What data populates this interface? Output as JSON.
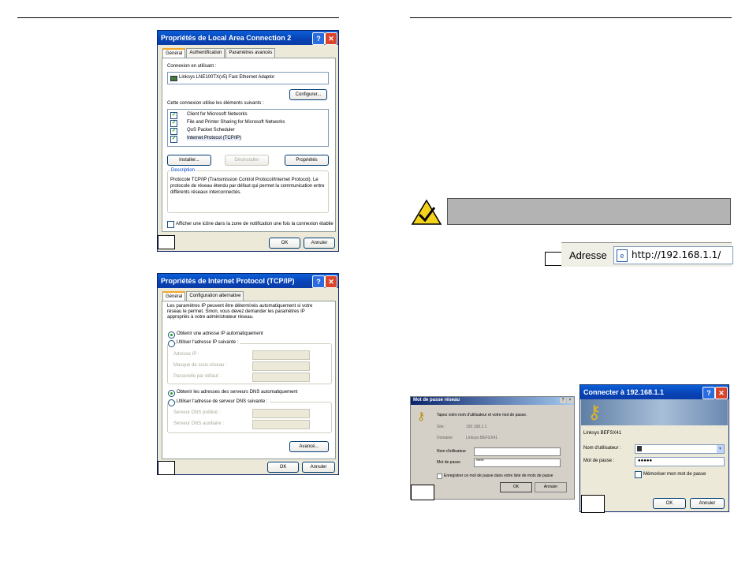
{
  "dialog1": {
    "title": "Propriétés de Local Area Connection 2",
    "tabs": [
      "Général",
      "Authentification",
      "Paramètres avancés"
    ],
    "connect_label": "Connexion en utilisant :",
    "adapter": "Linksys LNE100TX(v5) Fast Ethernet Adaptor",
    "configure_btn": "Configurer...",
    "items_label": "Cette connexion utilise les éléments suivants :",
    "items": [
      "Client for Microsoft Networks",
      "File and Printer Sharing for Microsoft Networks",
      "QoS Packet Scheduler",
      "Internet Protocol (TCP/IP)"
    ],
    "install_btn": "Installer...",
    "uninstall_btn": "Désinstaller",
    "properties_btn": "Propriétés",
    "description_label": "Description",
    "description_lines": [
      "Protocole TCP/IP (Transmission Control Protocol/Internet Protocol). Le",
      "protocole de réseau étendu par défaut qui permet la communication entre",
      "différents réseaux interconnectés."
    ],
    "notify_label": "Afficher une icône dans la zone de notification une fois la connexion établie",
    "ok_btn": "OK",
    "cancel_btn": "Annuler"
  },
  "dialog2": {
    "title": "Propriétés de Internet Protocol (TCP/IP)",
    "tabs": [
      "Général",
      "Configuration alternative"
    ],
    "intro_lines": [
      "Les paramètres IP peuvent être déterminés automatiquement si votre",
      "réseau le permet. Sinon, vous devez demander les paramètres IP",
      "appropriés à votre administrateur réseau."
    ],
    "ip_auto": "Obtenir une adresse IP automatiquement",
    "ip_manual": "Utiliser l'adresse IP suivante :",
    "ip_fields": [
      "Adresse IP :",
      "Masque de sous-réseau :",
      "Passerelle par défaut :"
    ],
    "dns_auto": "Obtenir les adresses des serveurs DNS automatiquement",
    "dns_manual": "Utiliser l'adresse de serveur DNS suivante :",
    "dns_fields": [
      "Serveur DNS préféré :",
      "Serveur DNS auxiliaire :"
    ],
    "advanced_btn": "Avancé...",
    "ok_btn": "OK",
    "cancel_btn": "Annuler"
  },
  "address_bar": {
    "label": "Adresse",
    "url": "http://192.168.1.1/"
  },
  "dialog3": {
    "title": "Mot de passe réseau",
    "prompt": "Tapez votre nom d'utilisateur et votre mot de passe.",
    "site_label": "Site :",
    "site_value": "192.168.1.1",
    "domain_label": "Domaine",
    "domain_value": "Linksys BEFSX41",
    "user_label": "Nom d'utilisateur",
    "pass_label": "Mot de passe",
    "pass_value": "*****",
    "save_label": "Enregistrer ce mot de passe dans votre liste de mots de passe",
    "ok_btn": "OK",
    "cancel_btn": "Annuler"
  },
  "dialog4": {
    "title": "Connecter à 192.168.1.1",
    "realm": "Linksys BEFSX41",
    "user_label": "Nom d'utilisateur :",
    "pass_label": "Mot de passe :",
    "pass_value": "●●●●●",
    "remember_label": "Mémoriser mon mot de passe",
    "ok_btn": "OK",
    "cancel_btn": "Annuler"
  },
  "colors": {
    "xp_title": "#0a5fd8",
    "note_bar": "#b3b3b3",
    "note_icon": "#f2d21b"
  },
  "icons": [
    "help-icon",
    "close-icon",
    "note-check-icon",
    "ie-page-icon",
    "keys-icon"
  ]
}
